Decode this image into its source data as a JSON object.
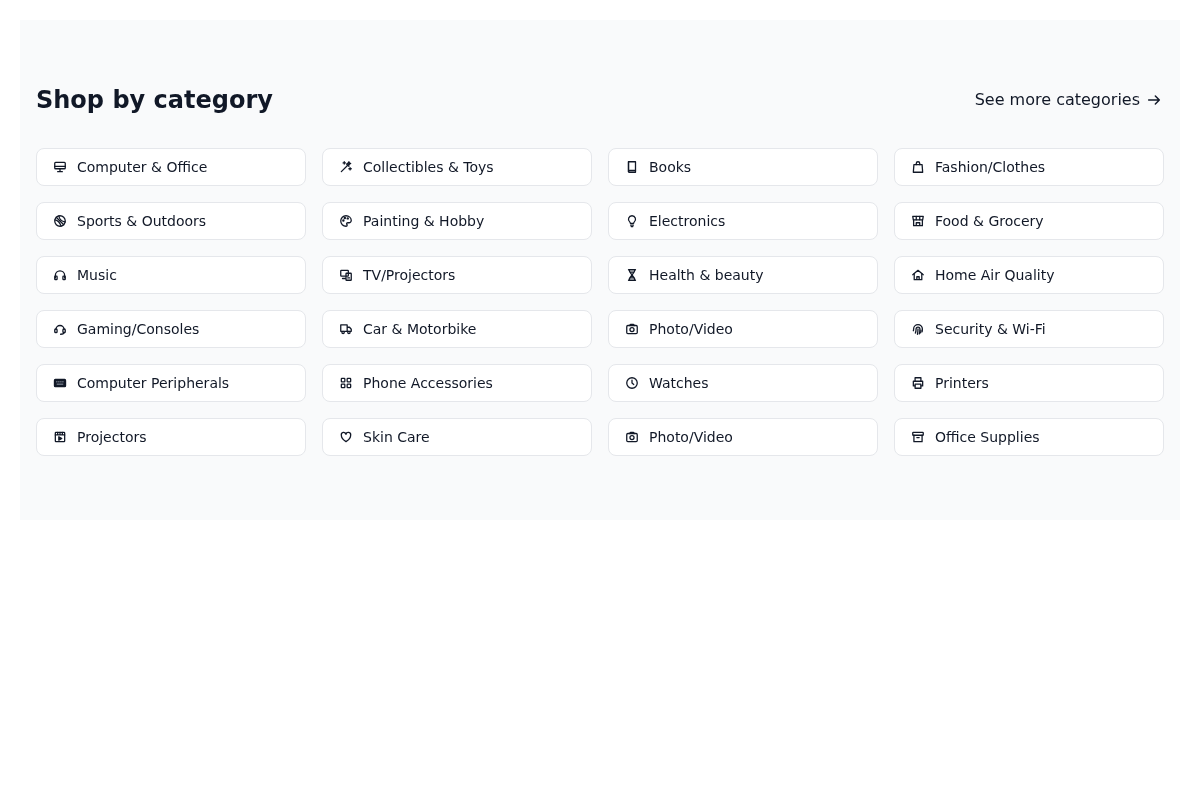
{
  "section": {
    "title": "Shop by category",
    "link": {
      "label": "See more categories"
    }
  },
  "categories": [
    {
      "label": "Computer & Office"
    },
    {
      "label": "Collectibles & Toys"
    },
    {
      "label": "Books"
    },
    {
      "label": "Fashion/Clothes"
    },
    {
      "label": "Sports & Outdoors"
    },
    {
      "label": "Painting & Hobby"
    },
    {
      "label": "Electronics"
    },
    {
      "label": "Food & Grocery"
    },
    {
      "label": "Music"
    },
    {
      "label": "TV/Projectors"
    },
    {
      "label": "Health & beauty"
    },
    {
      "label": "Home Air Quality"
    },
    {
      "label": "Gaming/Consoles"
    },
    {
      "label": "Car & Motorbike"
    },
    {
      "label": "Photo/Video"
    },
    {
      "label": "Security & Wi-Fi"
    },
    {
      "label": "Computer Peripherals"
    },
    {
      "label": "Phone Accessories"
    },
    {
      "label": "Watches"
    },
    {
      "label": "Printers"
    },
    {
      "label": "Projectors"
    },
    {
      "label": "Skin Care"
    },
    {
      "label": "Photo/Video"
    },
    {
      "label": "Office Supplies"
    }
  ]
}
